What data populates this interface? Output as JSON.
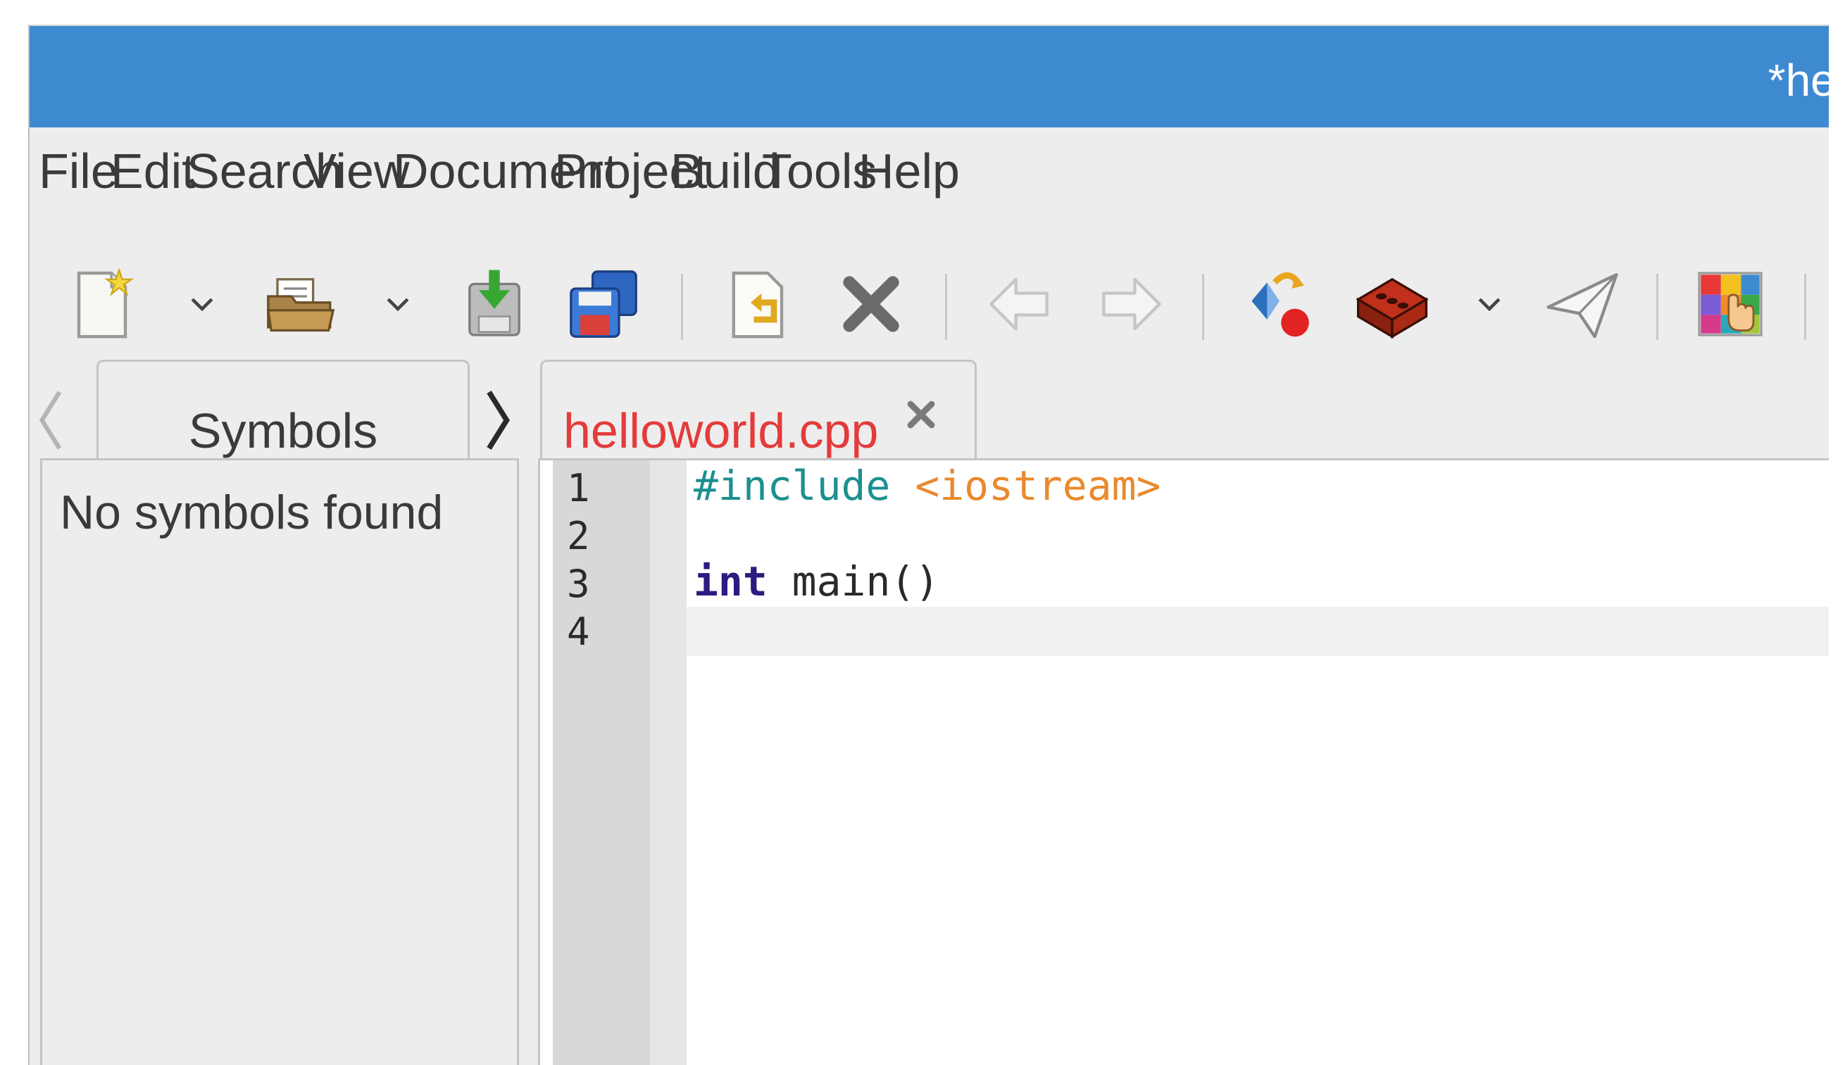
{
  "window": {
    "title": "*hellow"
  },
  "menu": [
    {
      "label": "File"
    },
    {
      "label": "Edit"
    },
    {
      "label": "Search"
    },
    {
      "label": "View"
    },
    {
      "label": "Document"
    },
    {
      "label": "Project"
    },
    {
      "label": "Build"
    },
    {
      "label": "Tools"
    },
    {
      "label": "Help"
    }
  ],
  "toolbar": {
    "buttons": [
      {
        "icon": "new-file-icon"
      },
      {
        "icon": "open-folder-icon"
      },
      {
        "icon": "save-icon"
      },
      {
        "icon": "save-all-icon"
      },
      {
        "icon": "revert-icon"
      },
      {
        "icon": "close-icon"
      },
      {
        "icon": "back-arrow-icon"
      },
      {
        "icon": "forward-arrow-icon"
      },
      {
        "icon": "compile-icon"
      },
      {
        "icon": "build-brick-icon"
      },
      {
        "icon": "execute-paper-plane-icon"
      },
      {
        "icon": "color-chooser-icon"
      }
    ]
  },
  "sidebar": {
    "tab_label": "Symbols",
    "empty_message": "No symbols found"
  },
  "editor": {
    "tab_label": "helloworld.cpp",
    "lines": [
      {
        "number": "1",
        "directive": "#include",
        "space": " ",
        "header": "<iostream>"
      },
      {
        "number": "2"
      },
      {
        "number": "3",
        "keyword": "int",
        "rest": " main()"
      },
      {
        "number": "4"
      }
    ]
  },
  "colors": {
    "titlebar": "#3e8ad0",
    "tab_text": "#e43b3b",
    "preprocessor": "#1d8f8f",
    "include_header": "#e88a2e",
    "keyword": "#2a1c80"
  }
}
